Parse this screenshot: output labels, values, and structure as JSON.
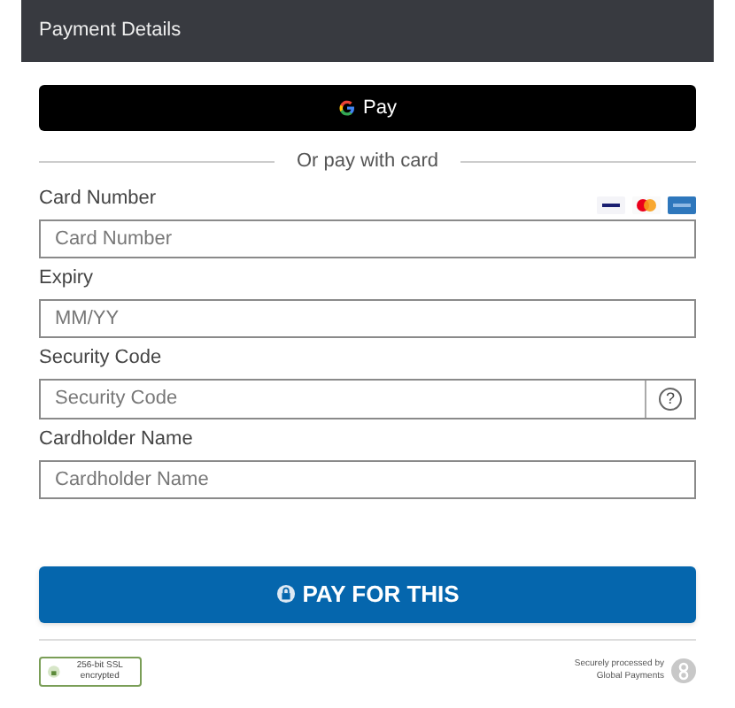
{
  "header": {
    "title": "Payment Details"
  },
  "wallet_button": {
    "label": "Pay"
  },
  "divider": {
    "label": "Or pay with card"
  },
  "fields": [
    {
      "kind": "card",
      "label": "Card Number",
      "placeholder": "Card Number"
    },
    {
      "kind": "plain",
      "label": "Expiry",
      "placeholder": "MM/YY"
    },
    {
      "kind": "help",
      "label": "Security Code",
      "placeholder": "Security Code",
      "help": "?"
    },
    {
      "kind": "plain",
      "label": "Cardholder Name",
      "placeholder": "Cardholder Name"
    }
  ],
  "pay_button": {
    "label": "PAY FOR THIS"
  },
  "footer": {
    "ssl_badge": "256-bit SSL encrypted",
    "processor": "Securely processed by Global Payments"
  }
}
